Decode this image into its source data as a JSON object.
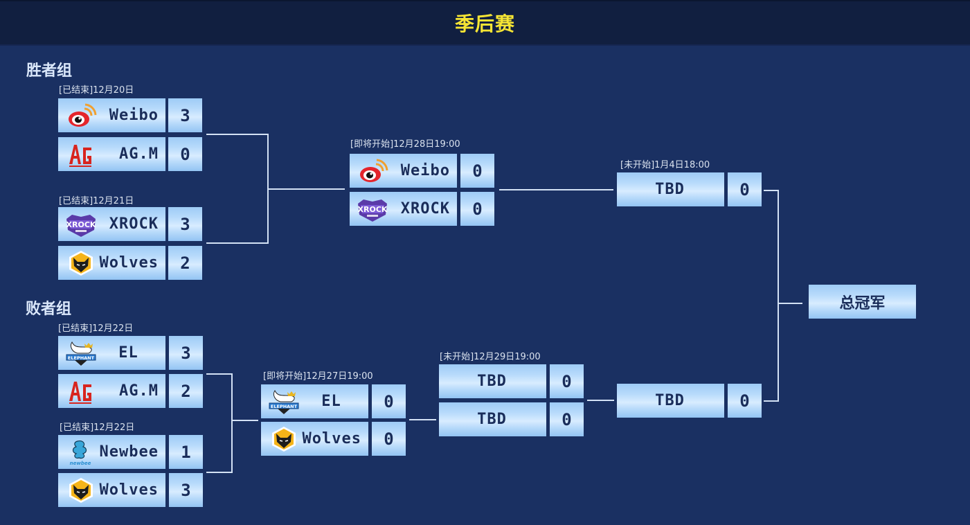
{
  "header": {
    "title": "季后赛"
  },
  "groups": {
    "winners": "胜者组",
    "losers": "败者组"
  },
  "matches": {
    "w1": {
      "label": "[已结束]12月20日",
      "teams": [
        {
          "name": "Weibo",
          "logo": "weibo-logo",
          "score": "3"
        },
        {
          "name": "AG.M",
          "logo": "ag-logo",
          "score": "0"
        }
      ]
    },
    "w2": {
      "label": "[已结束]12月21日",
      "teams": [
        {
          "name": "XROCK",
          "logo": "xrock-logo",
          "score": "3"
        },
        {
          "name": "Wolves",
          "logo": "wolves-logo",
          "score": "2"
        }
      ]
    },
    "w3": {
      "label": "[即将开始]12月28日19:00",
      "teams": [
        {
          "name": "Weibo",
          "logo": "weibo-logo",
          "score": "0"
        },
        {
          "name": "XROCK",
          "logo": "xrock-logo",
          "score": "0"
        }
      ]
    },
    "final_top": {
      "label": "[未开始]1月4日18:00",
      "teams": [
        {
          "name": "TBD",
          "score": "0"
        }
      ]
    },
    "l1": {
      "label": "[已结束]12月22日",
      "teams": [
        {
          "name": "EL",
          "logo": "elephant-logo",
          "score": "3"
        },
        {
          "name": "AG.M",
          "logo": "ag-logo",
          "score": "2"
        }
      ]
    },
    "l2": {
      "label": "[已结束]12月22日",
      "teams": [
        {
          "name": "Newbee",
          "logo": "newbee-logo",
          "score": "1"
        },
        {
          "name": "Wolves",
          "logo": "wolves-logo",
          "score": "3"
        }
      ]
    },
    "l3": {
      "label": "[即将开始]12月27日19:00",
      "teams": [
        {
          "name": "EL",
          "logo": "elephant-logo",
          "score": "0"
        },
        {
          "name": "Wolves",
          "logo": "wolves-logo",
          "score": "0"
        }
      ]
    },
    "l4": {
      "label": "[未开始]12月29日19:00",
      "teams": [
        {
          "name": "TBD",
          "score": "0"
        },
        {
          "name": "TBD",
          "score": "0"
        }
      ]
    },
    "final_bottom": {
      "teams": [
        {
          "name": "TBD",
          "score": "0"
        }
      ]
    }
  },
  "champion": {
    "label": "总冠军"
  },
  "colors": {
    "background": "#1a3062",
    "header_bg": "#111f40",
    "title": "#f6e534",
    "cell_text": "#1a2d5a",
    "connector": "#d4e2f5"
  }
}
